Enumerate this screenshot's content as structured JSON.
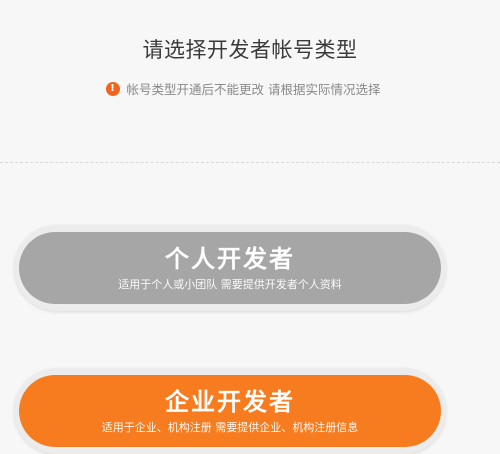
{
  "header": {
    "title": "请选择开发者帐号类型",
    "notice": "帐号类型开通后不能更改 请根据实际情况选择",
    "notice_icon": "!"
  },
  "options": {
    "personal": {
      "title": "个人开发者",
      "subtitle": "适用于个人或小团队 需要提供开发者个人资料",
      "color": "#a6a6a6"
    },
    "enterprise": {
      "title": "企业开发者",
      "subtitle": "适用于企业、机构注册 需要提供企业、机构注册信息",
      "color": "#f77c1f"
    }
  },
  "colors": {
    "accent": "#f0641e",
    "background": "#f7f7f7"
  }
}
